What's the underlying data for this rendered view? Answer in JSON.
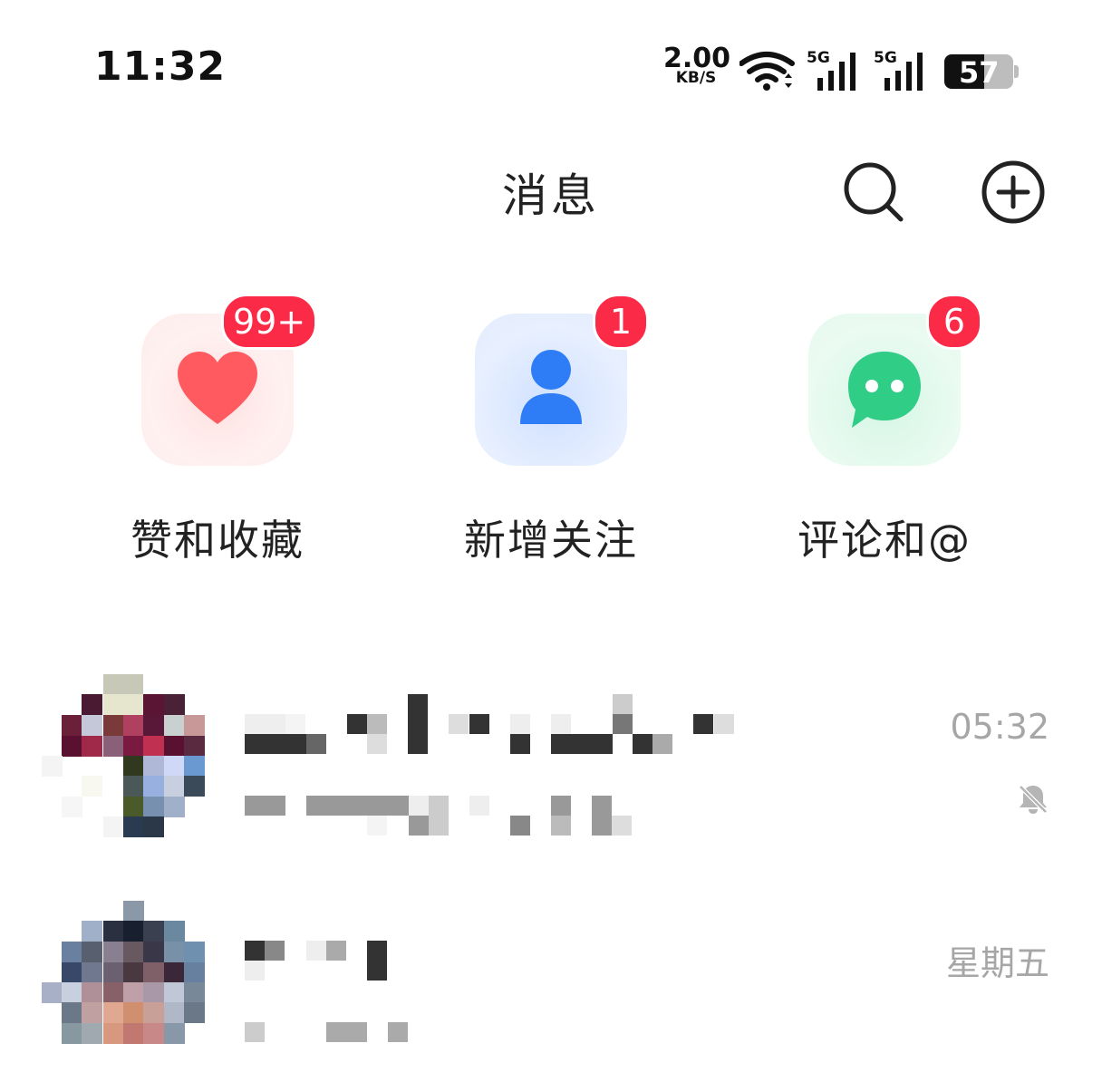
{
  "status_bar": {
    "time": "11:32",
    "net_speed_value": "2.00",
    "net_speed_unit": "KB/S",
    "sim1_label": "5G",
    "sim2_label": "5G",
    "battery_level": "57"
  },
  "header": {
    "title": "消息",
    "search_icon": "search-icon",
    "add_icon": "add-circle-icon"
  },
  "entries": [
    {
      "label": "赞和收藏",
      "badge": "99+",
      "icon": "heart-icon",
      "color": "#fe5a5f"
    },
    {
      "label": "新增关注",
      "badge": "1",
      "icon": "person-icon",
      "color": "#2f7df6"
    },
    {
      "label": "评论和@",
      "badge": "6",
      "icon": "chat-bubble-icon",
      "color": "#2fcd86"
    }
  ],
  "badge_color": "#fb2a47",
  "conversations": [
    {
      "time": "05:32",
      "muted": true
    },
    {
      "time": "星期五",
      "muted": false
    }
  ]
}
